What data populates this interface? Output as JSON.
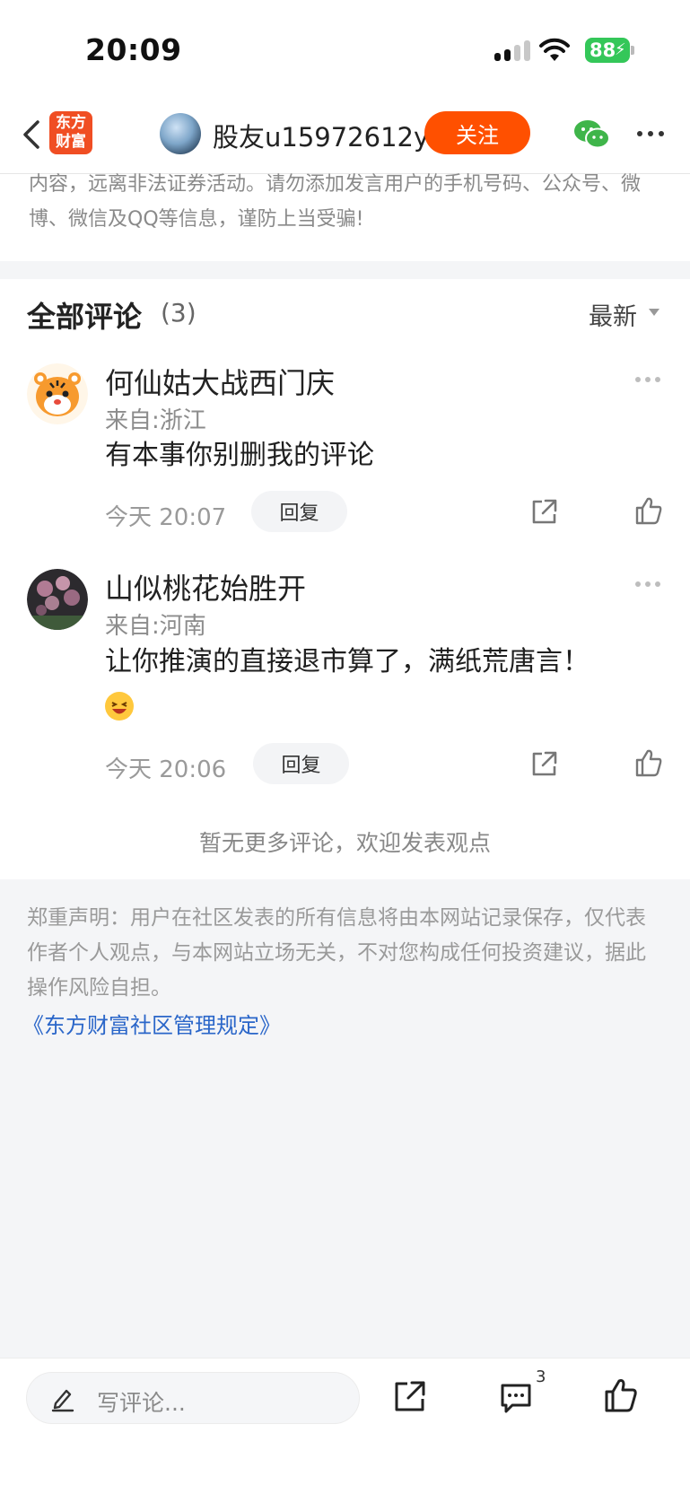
{
  "status_bar": {
    "time": "20:09",
    "battery": "88"
  },
  "header": {
    "brand": [
      "东方",
      "财富"
    ],
    "author_name": "股友u15972612y",
    "follow_label": "关注"
  },
  "warning_text": "内容，远离非法证券活动。请勿添加发言用户的手机号码、公众号、微博、微信及QQ等信息，谨防上当受骗!",
  "comments_section": {
    "title": "全部评论",
    "count": "(3)",
    "sort_label": "最新"
  },
  "comments": [
    {
      "name": "何仙姑大战西门庆",
      "location": "来自:浙江",
      "body": "有本事你别删我的评论",
      "time": "今天 20:07",
      "reply_label": "回复"
    },
    {
      "name": "山似桃花始胜开",
      "location": "来自:河南",
      "body": "让你推演的直接退市算了，满纸荒唐言！",
      "time": "今天 20:06",
      "reply_label": "回复"
    }
  ],
  "no_more_text": "暂无更多评论，欢迎发表观点",
  "disclaimer": {
    "text": "郑重声明：用户在社区发表的所有信息将由本网站记录保存，仅代表作者个人观点，与本网站立场无关，不对您构成任何投资建议，据此操作风险自担。",
    "rules_link": "《东方财富社区管理规定》"
  },
  "bottom_bar": {
    "input_placeholder": "写评论...",
    "comment_badge": "3"
  },
  "colors": {
    "accent": "#ff5000",
    "brand": "#f04e23",
    "link": "#2a66c9",
    "battery": "#34c759"
  }
}
